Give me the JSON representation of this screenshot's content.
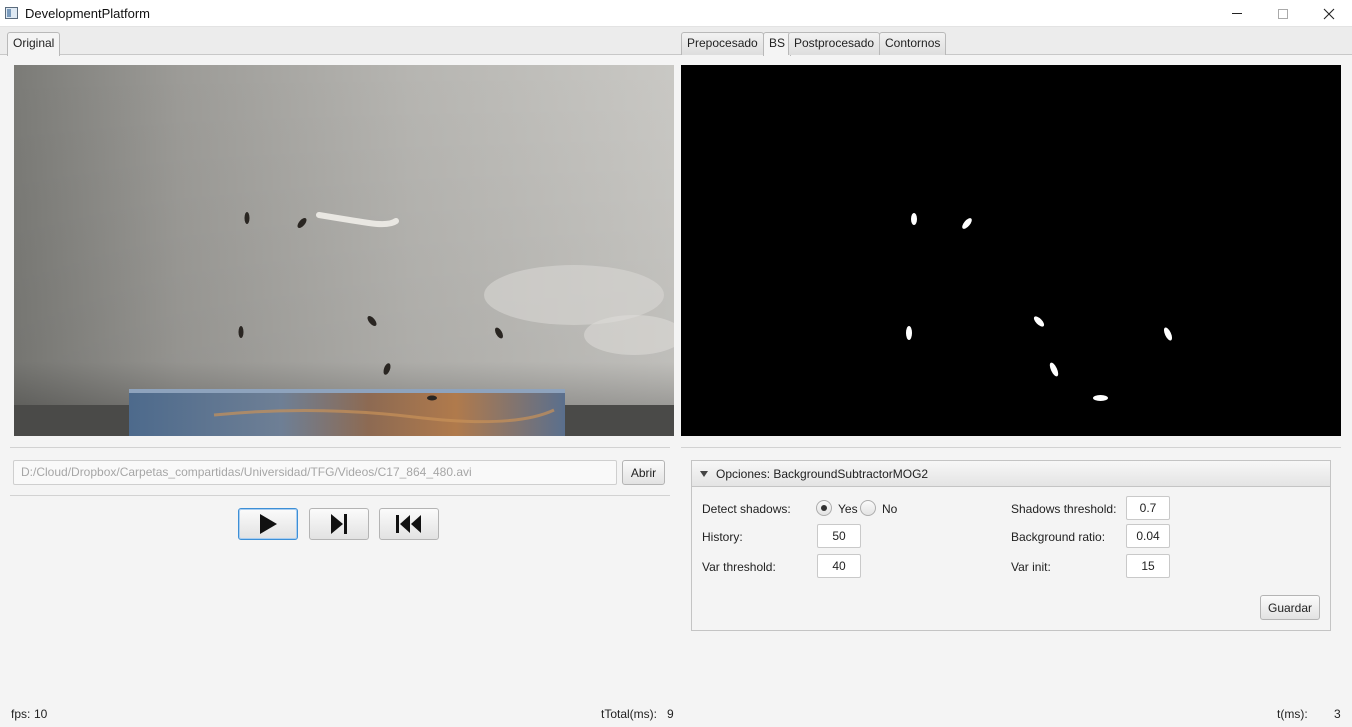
{
  "window": {
    "title": "DevelopmentPlatform"
  },
  "tabs_left": [
    {
      "label": "Original",
      "active": true
    }
  ],
  "tabs_right": [
    {
      "label": "Prepocesado",
      "active": false
    },
    {
      "label": "BS",
      "active": true
    },
    {
      "label": "Postprocesado",
      "active": false
    },
    {
      "label": "Contornos",
      "active": false
    }
  ],
  "file": {
    "path_placeholder": "D:/Cloud/Dropbox/Carpetas_compartidas/Universidad/TFG/Videos/C17_864_480.avi",
    "open_label": "Abrir"
  },
  "controls": {
    "play_icon": "play-icon",
    "step_icon": "step-forward-icon",
    "rewind_icon": "rewind-icon"
  },
  "options": {
    "title": "Opciones: BackgroundSubtractorMOG2",
    "detect_shadows_label": "Detect shadows:",
    "yes_label": "Yes",
    "no_label": "No",
    "detect_shadows_value": "Yes",
    "history_label": "History:",
    "history_value": "50",
    "var_threshold_label": "Var threshold:",
    "var_threshold_value": "40",
    "shadows_threshold_label": "Shadows threshold:",
    "shadows_threshold_value": "0.7",
    "background_ratio_label": "Background ratio:",
    "background_ratio_value": "0.04",
    "var_init_label": "Var init:",
    "var_init_value": "15",
    "save_label": "Guardar"
  },
  "status": {
    "fps_label": "fps:",
    "fps_value": "10",
    "ttotal_label": "tTotal(ms):",
    "ttotal_value": "9",
    "t_label": "t(ms):",
    "t_value": "3"
  },
  "colors": {
    "focus_accent": "#3d8fd6",
    "bs_background": "#000000",
    "bs_foreground": "#ffffff"
  }
}
